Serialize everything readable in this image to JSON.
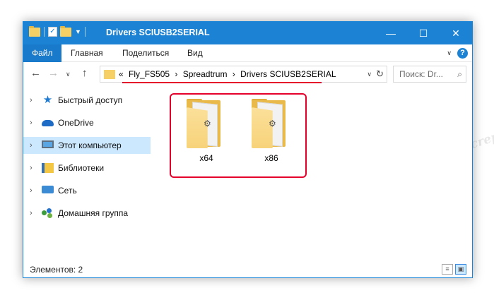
{
  "window": {
    "title": "Drivers SCIUSB2SERIAL",
    "controls": {
      "minimize": "—",
      "maximize": "☐",
      "close": "✕"
    }
  },
  "ribbon": {
    "tabs": [
      "Файл",
      "Главная",
      "Поделиться",
      "Вид"
    ],
    "help": "?"
  },
  "address": {
    "prefix": "«",
    "crumbs": [
      "Fly_FS505",
      "Spreadtrum",
      "Drivers SCIUSB2SERIAL"
    ],
    "separator": "›"
  },
  "search": {
    "placeholder": "Поиск: Dr..."
  },
  "sidebar": {
    "items": [
      {
        "label": "Быстрый доступ",
        "icon": "star-icon"
      },
      {
        "label": "OneDrive",
        "icon": "cloud-icon"
      },
      {
        "label": "Этот компьютер",
        "icon": "computer-icon",
        "selected": true
      },
      {
        "label": "Библиотеки",
        "icon": "library-icon"
      },
      {
        "label": "Сеть",
        "icon": "network-icon"
      },
      {
        "label": "Домашняя группа",
        "icon": "homegroup-icon"
      }
    ]
  },
  "content": {
    "folders": [
      {
        "name": "x64"
      },
      {
        "name": "x86"
      }
    ]
  },
  "status": {
    "text": "Элементов: 2"
  },
  "watermark": "Soringpcrepair.com",
  "colors": {
    "accent": "#1c83d4",
    "highlight": "#e4002b",
    "selection": "#cce8ff"
  }
}
